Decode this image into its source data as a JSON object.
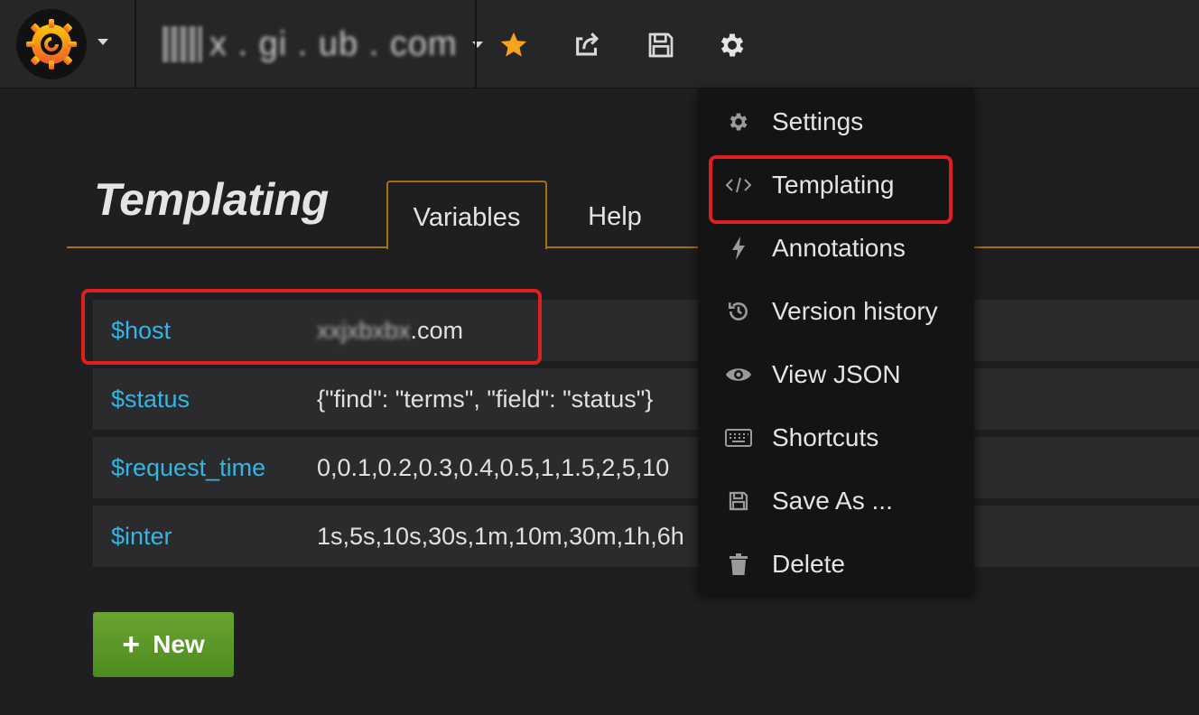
{
  "navbar": {
    "dashboard_title": "x . gi . ub . com",
    "icons": [
      "grafana-logo",
      "star-icon",
      "share-icon",
      "save-icon",
      "gear-icon"
    ],
    "accent_color": "#f7a31c"
  },
  "page": {
    "title": "Templating",
    "tabs": [
      {
        "label": "Variables",
        "active": true
      },
      {
        "label": "Help",
        "active": false
      }
    ]
  },
  "variables": [
    {
      "name": "$host",
      "definition": "xxjxbxbx.com",
      "definition_suffix": ".com",
      "definition_blurred": "xxjxbxbx",
      "highlighted": true
    },
    {
      "name": "$status",
      "definition": "{\"find\": \"terms\", \"field\": \"status\"}"
    },
    {
      "name": "$request_time",
      "definition": "0,0.1,0.2,0.3,0.4,0.5,1,1.5,2,5,10"
    },
    {
      "name": "$inter",
      "definition": "1s,5s,10s,30s,1m,10m,30m,1h,6h"
    }
  ],
  "new_button": {
    "label": "New",
    "icon": "plus-icon",
    "color": "#5a9626"
  },
  "settings_menu": {
    "items": [
      {
        "label": "Settings",
        "icon": "gear-icon"
      },
      {
        "label": "Templating",
        "icon": "code-icon",
        "highlighted": true
      },
      {
        "label": "Annotations",
        "icon": "bolt-icon"
      },
      {
        "label": "Version history",
        "icon": "history-icon"
      },
      {
        "label": "View JSON",
        "icon": "eye-icon"
      },
      {
        "label": "Shortcuts",
        "icon": "keyboard-icon"
      },
      {
        "label": "Save As ...",
        "icon": "save-icon"
      },
      {
        "label": "Delete",
        "icon": "trash-icon"
      }
    ]
  },
  "annotation_color": "#e02020"
}
